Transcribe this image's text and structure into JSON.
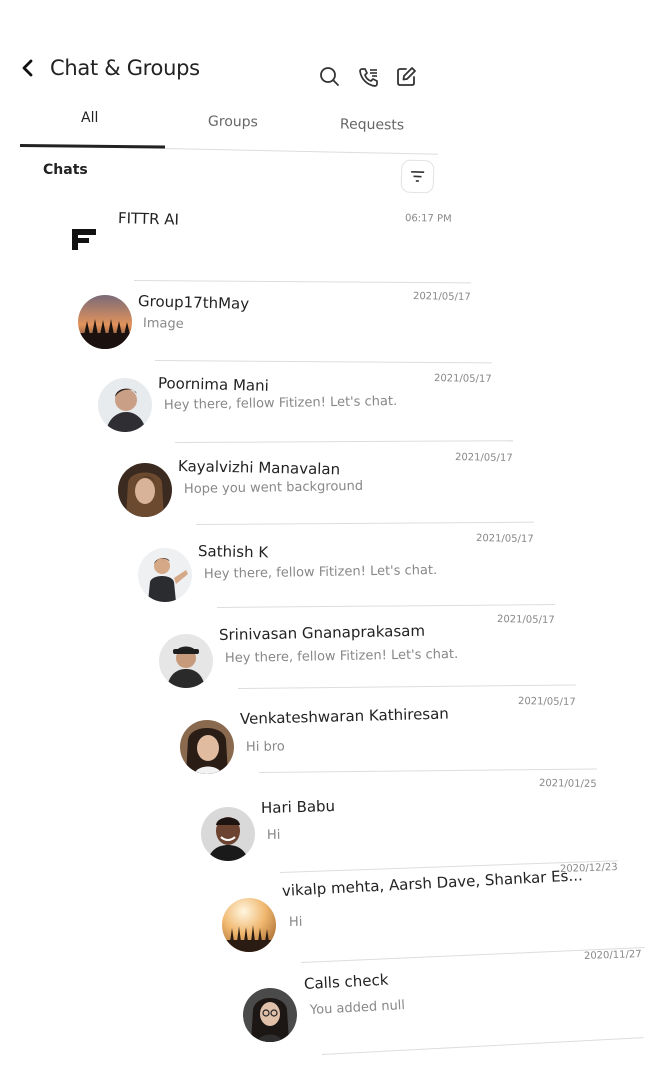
{
  "header": {
    "title": "Chat & Groups",
    "icons": [
      "back-arrow-icon",
      "search-icon",
      "phone-log-icon",
      "compose-icon"
    ]
  },
  "tabs": [
    {
      "label": "All",
      "active": true
    },
    {
      "label": "Groups",
      "active": false
    },
    {
      "label": "Requests",
      "active": false
    }
  ],
  "section": {
    "label": "Chats",
    "filter_icon": "filter-icon"
  },
  "chats": [
    {
      "name": "FITTR AI",
      "message": "",
      "date": "06:17 PM"
    },
    {
      "name": "Group17thMay",
      "message": "Image",
      "date": "2021/05/17"
    },
    {
      "name": "Poornima Mani",
      "message": "Hey there, fellow Fitizen! Let's chat.",
      "date": "2021/05/17"
    },
    {
      "name": "Kayalvizhi Manavalan",
      "message": "Hope you went background",
      "date": "2021/05/17"
    },
    {
      "name": "Sathish K",
      "message": "Hey there, fellow Fitizen! Let's chat.",
      "date": "2021/05/17"
    },
    {
      "name": "Srinivasan Gnanaprakasam",
      "message": "Hey there, fellow Fitizen! Let's chat.",
      "date": "2021/05/17"
    },
    {
      "name": "Venkateshwaran Kathiresan",
      "message": "Hi bro",
      "date": "2021/05/17"
    },
    {
      "name": "Hari Babu",
      "message": "Hi",
      "date": "2021/01/25"
    },
    {
      "name": "vikalp mehta, Aarsh Dave, Shankar Es...",
      "message": "Hi",
      "date": "2020/12/23"
    },
    {
      "name": "Calls check",
      "message": "You added null",
      "date": "2020/11/27"
    }
  ]
}
